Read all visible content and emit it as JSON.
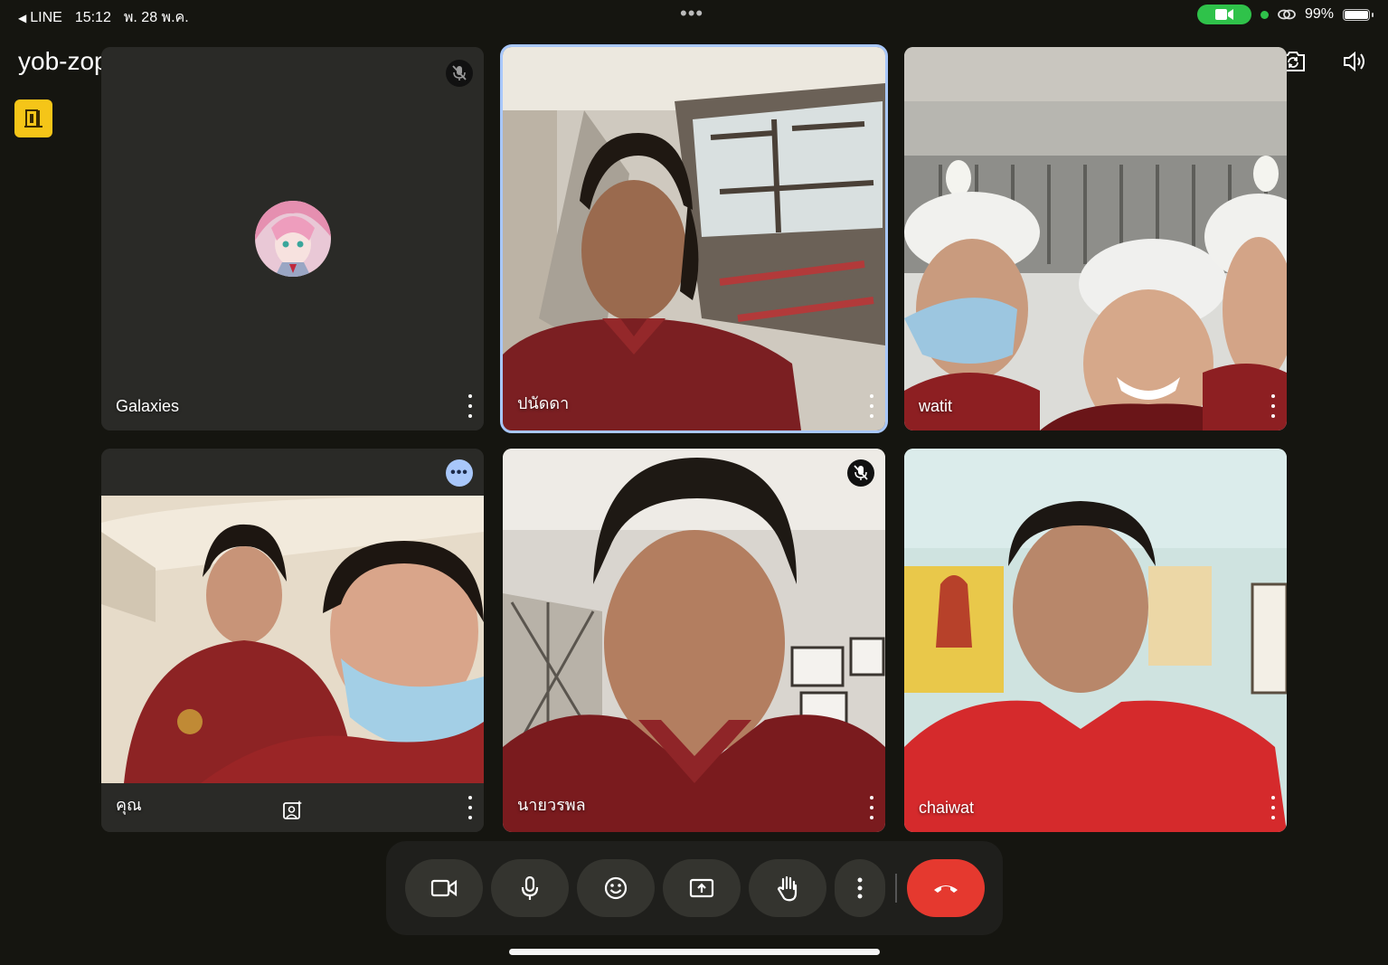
{
  "status_bar": {
    "back_app": "LINE",
    "time": "15:12",
    "date": "พ. 28 พ.ค.",
    "battery": "99%",
    "battery_level": 0.99
  },
  "meeting": {
    "code": "yob-zopp-gna"
  },
  "participants": [
    {
      "name": "Galaxies",
      "muted": true,
      "speaking": false,
      "active": false
    },
    {
      "name": "ปนัดดา",
      "muted": false,
      "speaking": false,
      "active": true
    },
    {
      "name": "watit",
      "muted": false,
      "speaking": false,
      "active": false
    },
    {
      "name": "คุณ",
      "muted": false,
      "speaking": true,
      "active": false
    },
    {
      "name": "นายวรพล",
      "muted": true,
      "speaking": false,
      "active": false
    },
    {
      "name": "chaiwat",
      "muted": false,
      "speaking": false,
      "active": false
    }
  ],
  "colors": {
    "accent": "#a8c7fa",
    "host_button": "#f5c518",
    "end_call": "#e5392f",
    "camera_pill": "#2fc24a"
  },
  "toolbar": {
    "buttons": [
      "camera-icon",
      "microphone-icon",
      "emoji-icon",
      "present-screen-icon",
      "raise-hand-icon",
      "more-options-icon",
      "end-call-icon"
    ]
  }
}
